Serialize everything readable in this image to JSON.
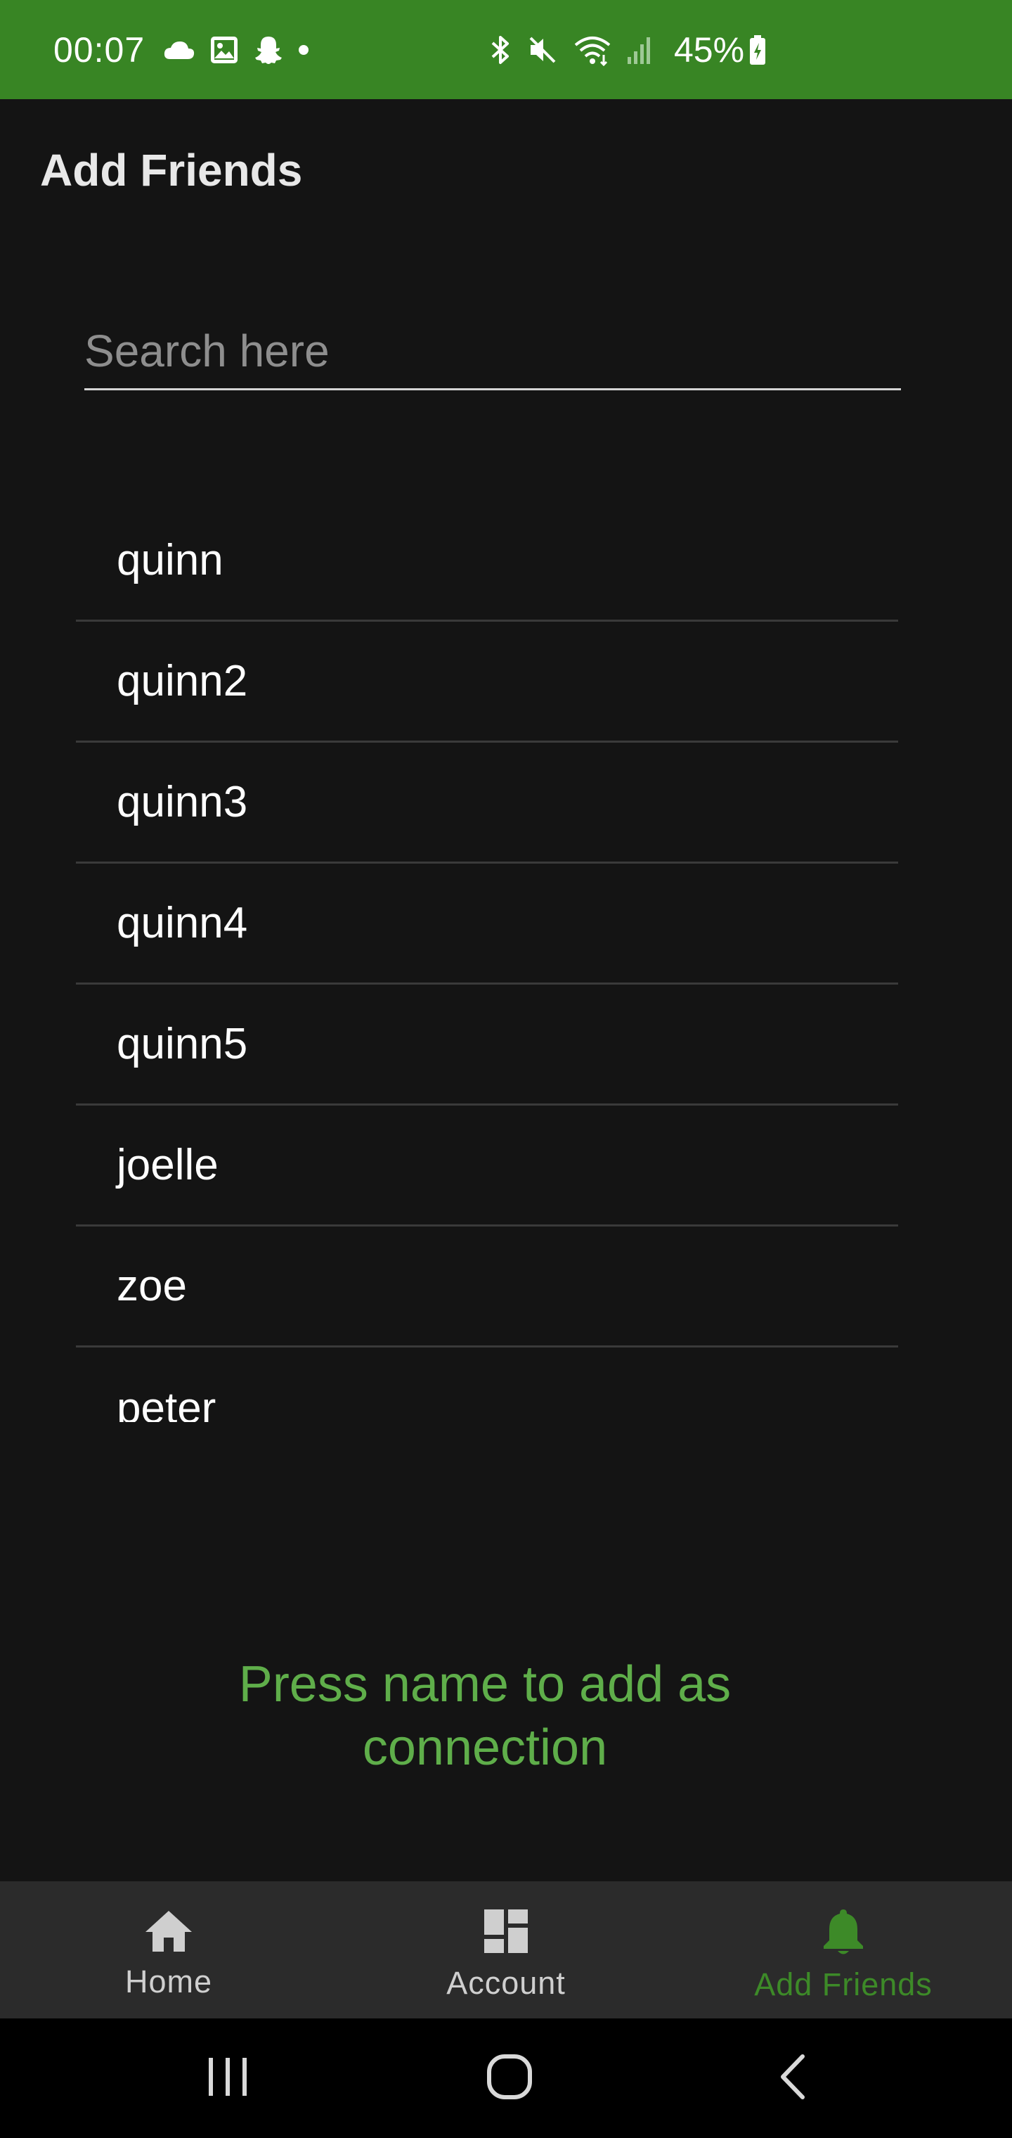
{
  "status_bar": {
    "time": "00:07",
    "battery": "45%",
    "icons_left": [
      "cloud-icon",
      "image-icon",
      "snapchat-icon",
      "dot-icon"
    ],
    "icons_right": [
      "bluetooth-icon",
      "mute-icon",
      "wifi-icon",
      "signal-icon",
      "battery-icon"
    ],
    "background": "#388524"
  },
  "header": {
    "title": "Add Friends"
  },
  "search": {
    "placeholder": "Search here",
    "value": ""
  },
  "users": [
    {
      "name": "quinn"
    },
    {
      "name": "quinn2"
    },
    {
      "name": "quinn3"
    },
    {
      "name": "quinn4"
    },
    {
      "name": "quinn5"
    },
    {
      "name": "joelle"
    },
    {
      "name": "zoe"
    },
    {
      "name": "peter"
    }
  ],
  "hint": {
    "line1": "Press name to add as",
    "line2": "connection",
    "color": "#5fae4a"
  },
  "bottom_nav": {
    "items": [
      {
        "label": "Home",
        "icon": "home-icon",
        "active": false
      },
      {
        "label": "Account",
        "icon": "dashboard-icon",
        "active": false
      },
      {
        "label": "Add Friends",
        "icon": "bell-icon",
        "active": true
      }
    ],
    "active_color": "#3d8a28"
  },
  "system_nav": {
    "buttons": [
      "recents-icon",
      "home-circle-icon",
      "back-icon"
    ]
  }
}
